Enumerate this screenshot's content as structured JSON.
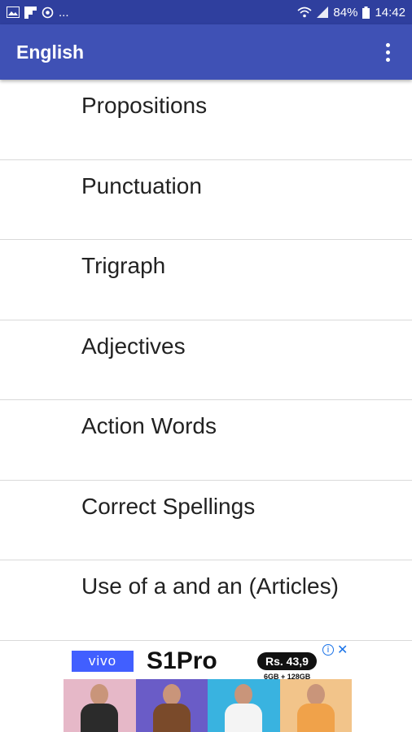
{
  "status_bar": {
    "left_icons": [
      "image-icon",
      "flipboard-icon",
      "data-saver-icon"
    ],
    "ellipsis": "...",
    "battery": "84%",
    "time": "14:42"
  },
  "app_bar": {
    "title": "English"
  },
  "list": {
    "items": [
      {
        "label": "Propositions"
      },
      {
        "label": "Punctuation"
      },
      {
        "label": "Trigraph"
      },
      {
        "label": "Adjectives"
      },
      {
        "label": "Action Words"
      },
      {
        "label": "Correct Spellings"
      },
      {
        "label": "Use of a and an (Articles)"
      }
    ]
  },
  "ad": {
    "brand": "vivo",
    "product": "S1Pro",
    "price": "Rs. 43,9",
    "spec": "6GB + 128GB"
  },
  "colors": {
    "status_bar": "#2f3f9e",
    "app_bar": "#3f51b5",
    "divider": "#d9d9d9"
  }
}
